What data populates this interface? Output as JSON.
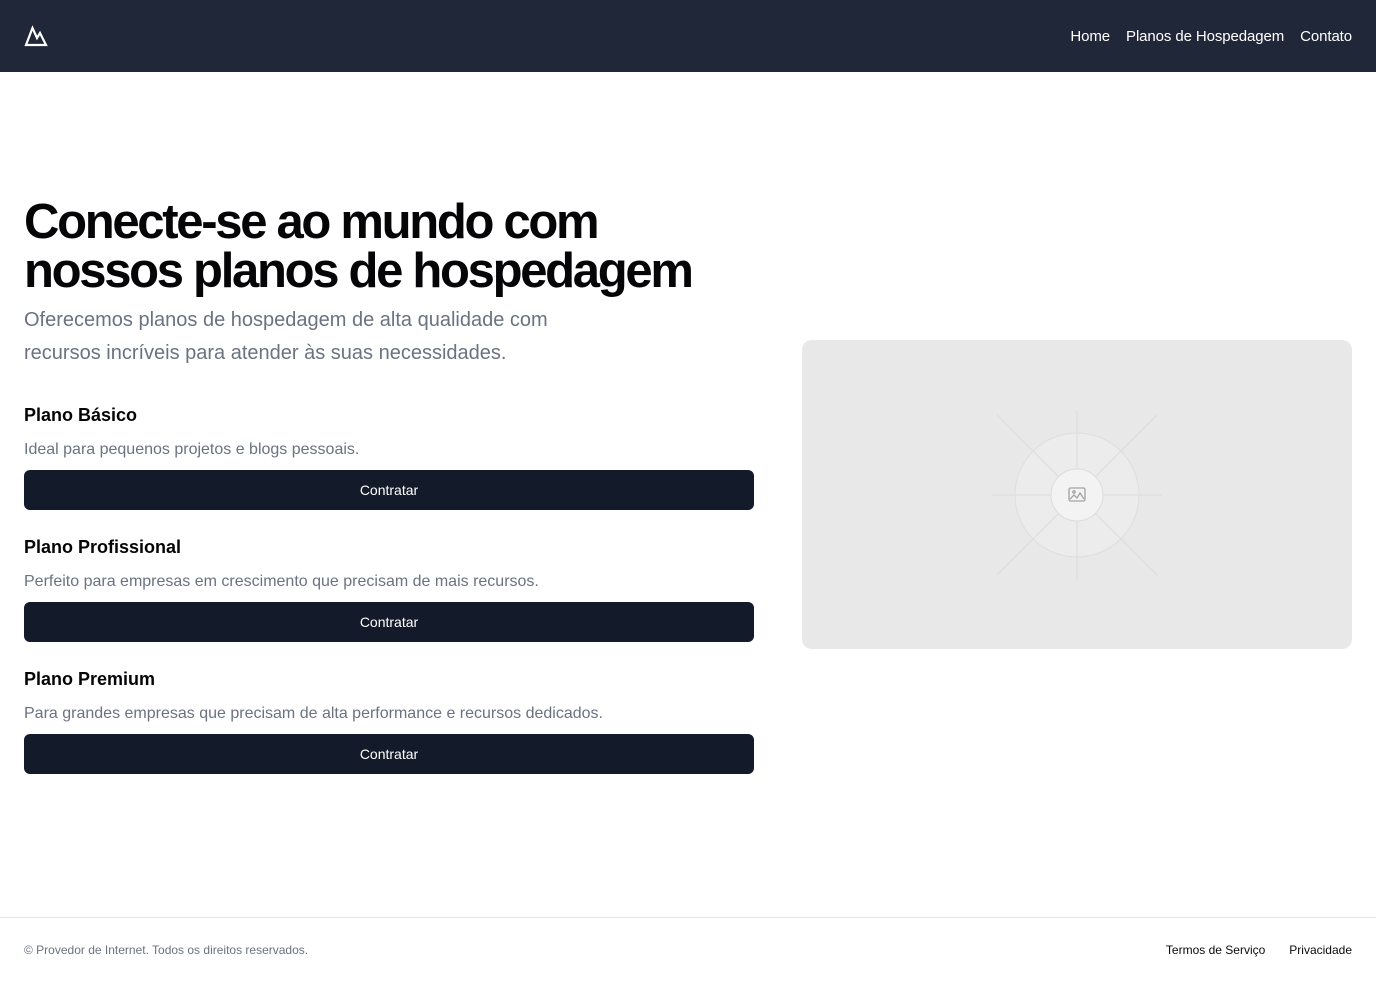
{
  "header": {
    "logo_icon": "mountain-icon",
    "nav": [
      {
        "label": "Home"
      },
      {
        "label": "Planos de Hospedagem"
      },
      {
        "label": "Contato"
      }
    ]
  },
  "hero": {
    "title": "Conecte-se ao mundo com nossos planos de hospedagem",
    "subtitle": "Oferecemos planos de hospedagem de alta qualidade com recursos incríveis para atender às suas necessidades."
  },
  "plans": [
    {
      "name": "Plano Básico",
      "description": "Ideal para pequenos projetos e blogs pessoais.",
      "button": "Contratar"
    },
    {
      "name": "Plano Profissional",
      "description": "Perfeito para empresas em crescimento que precisam de mais recursos.",
      "button": "Contratar"
    },
    {
      "name": "Plano Premium",
      "description": "Para grandes empresas que precisam de alta performance e recursos dedicados.",
      "button": "Contratar"
    }
  ],
  "image": {
    "icon": "image-placeholder-icon"
  },
  "footer": {
    "copyright": "© Provedor de Internet. Todos os direitos reservados.",
    "links": [
      {
        "label": "Termos de Serviço"
      },
      {
        "label": "Privacidade"
      }
    ]
  },
  "colors": {
    "header_bg": "#1f2738",
    "button_bg": "#131a2a",
    "muted_text": "#6b7280",
    "placeholder_bg": "#e8e8e8"
  }
}
